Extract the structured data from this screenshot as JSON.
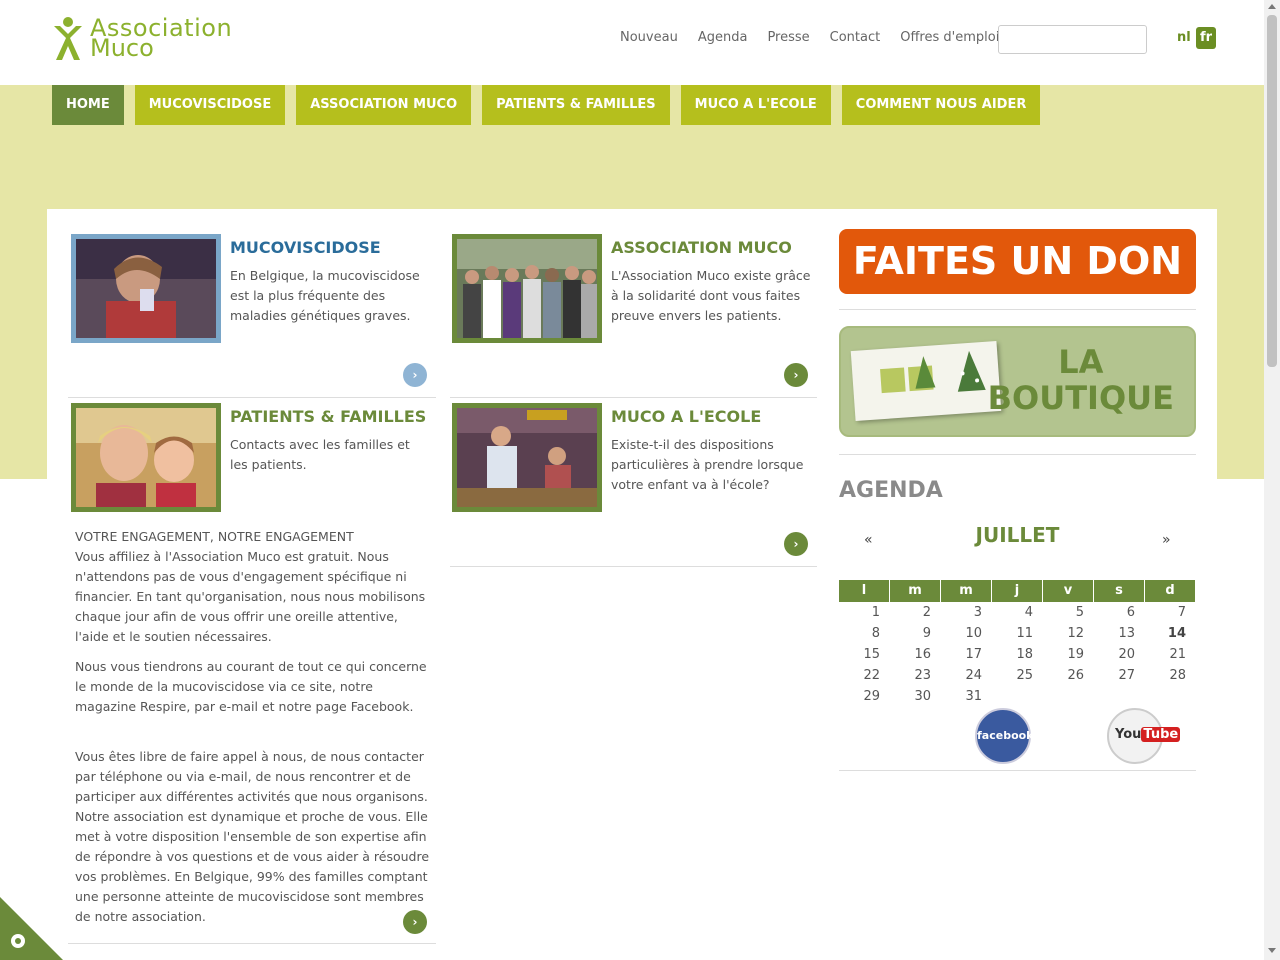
{
  "header": {
    "logo_line1": "Association",
    "logo_line2": "Muco",
    "links": [
      "Nouveau",
      "Agenda",
      "Presse",
      "Contact",
      "Offres d'emploi"
    ],
    "search_placeholder": "",
    "lang_nl": "nl",
    "lang_fr": "fr"
  },
  "nav": {
    "items": [
      "HOME",
      "MUCOVISCIDOSE",
      "ASSOCIATION MUCO",
      "PATIENTS & FAMILLES",
      "MUCO A L'ECOLE",
      "COMMENT NOUS AIDER"
    ]
  },
  "cards": [
    {
      "title": "MUCOVISCIDOSE",
      "text": "En Belgique, la mucoviscidose est la plus fréquente des maladies génétiques graves."
    },
    {
      "title": "ASSOCIATION MUCO",
      "text": "L'Association Muco existe grâce à la solidarité dont vous faites preuve envers les patients."
    },
    {
      "title": "PATIENTS & FAMILLES",
      "text": "Contacts avec les familles et les patients."
    },
    {
      "title": "MUCO A L'ECOLE",
      "text": "Existe-t-il des dispositions particulières à prendre lorsque votre enfant va à l'école?"
    }
  ],
  "engagement": {
    "heading": "VOTRE ENGAGEMENT, NOTRE ENGAGEMENT",
    "p1": "Vous affiliez à l'Association Muco est gratuit. Nous n'attendons pas de vous d'engagement spécifique ni financier. En tant qu'organisation, nous nous mobilisons chaque jour afin de vous offrir une oreille attentive, l'aide et le soutien nécessaires.",
    "p2": "Nous vous tiendrons au courant de tout ce qui concerne le monde de la mucoviscidose via ce site, notre magazine Respire, par e-mail et notre page Facebook.",
    "p3": "Vous êtes libre de faire appel à nous, de nous contacter par téléphone ou via e-mail, de nous rencontrer et de participer aux différentes activités que nous organisons. Notre association est dynamique et proche de vous. Elle met à votre disposition l'ensemble de son expertise afin de répondre à vos questions et de vous aider à résoudre vos problèmes. En Belgique, 99% des familles comptant une personne atteinte de mucoviscidose sont membres de notre association."
  },
  "sidebar": {
    "don_label": "FAITES UN DON",
    "boutique_line1": "LA",
    "boutique_line2": "BOUTIQUE",
    "agenda_title": "AGENDA",
    "prev": "«",
    "next": "»",
    "month": "JUILLET",
    "weekdays": [
      "l",
      "m",
      "m",
      "j",
      "v",
      "s",
      "d"
    ],
    "weeks": [
      [
        "1",
        "2",
        "3",
        "4",
        "5",
        "6",
        "7"
      ],
      [
        "8",
        "9",
        "10",
        "11",
        "12",
        "13",
        "14"
      ],
      [
        "15",
        "16",
        "17",
        "18",
        "19",
        "20",
        "21"
      ],
      [
        "22",
        "23",
        "24",
        "25",
        "26",
        "27",
        "28"
      ],
      [
        "29",
        "30",
        "31",
        "",
        "",
        "",
        ""
      ]
    ],
    "today": "14",
    "facebook_label": "facebook",
    "youtube_label1": "You",
    "youtube_label2": "Tube"
  },
  "colors": {
    "accent": "#6b8a3a",
    "nav": "#b5bf1d",
    "band": "#e6e6a6",
    "don": "#e2580b"
  }
}
